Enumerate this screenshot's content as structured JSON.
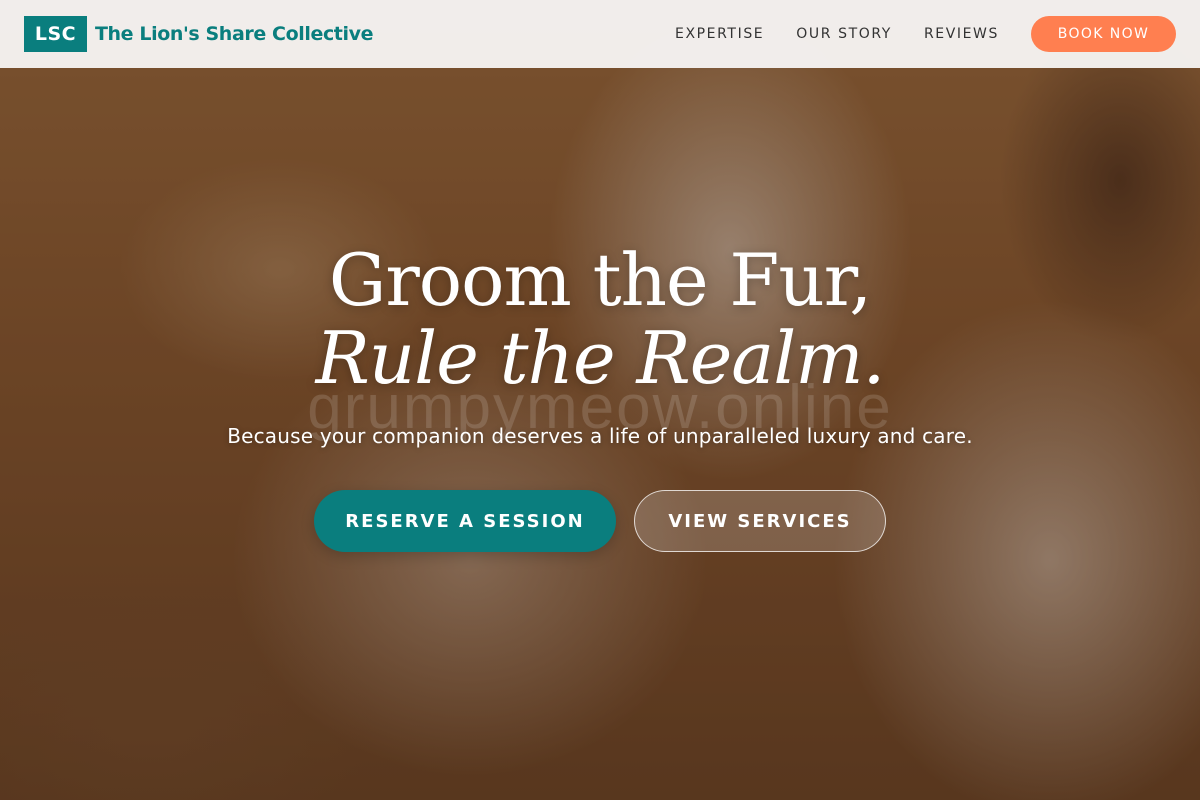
{
  "brand": {
    "logo_text": "LSC",
    "name": "The Lion's Share Collective"
  },
  "nav": {
    "items": [
      {
        "label": "EXPERTISE"
      },
      {
        "label": "OUR STORY"
      },
      {
        "label": "REVIEWS"
      }
    ],
    "book_label": "BOOK NOW"
  },
  "hero": {
    "headline_line1": "Groom the Fur,",
    "headline_line2": "Rule the Realm.",
    "subtitle": "Because your companion deserves a life of unparalleled luxury and care.",
    "primary_cta": "RESERVE A SESSION",
    "secondary_cta": "VIEW SERVICES",
    "watermark": "grumpymeow.online"
  },
  "colors": {
    "accent_teal": "#0a7e7e",
    "accent_coral": "#ff7f50",
    "header_bg": "#f6f4f2"
  }
}
